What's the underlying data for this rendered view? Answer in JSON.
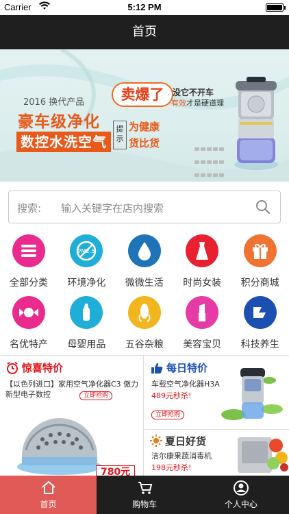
{
  "status_bar": {
    "carrier": "Carrier",
    "time": "5:12 PM"
  },
  "nav": {
    "title": "首页"
  },
  "banner": {
    "subline": "2016 换代产品",
    "headline": "豪车级净化",
    "headline2": "数控水洗空气",
    "hot": "卖爆了",
    "hot_note1": "没它不开车",
    "hot_note2_em": "有效",
    "hot_note2_rest": "才是硬道理",
    "tip": "提示",
    "claim1": "为健康",
    "claim2": "货比货",
    "page_count": 2,
    "active_page": 1
  },
  "search": {
    "label": "搜索:",
    "placeholder": "输入关键字在店内搜索"
  },
  "categories": [
    {
      "label": "全部分类",
      "icon": "list-icon",
      "color": "#ea2a8d"
    },
    {
      "label": "环境净化",
      "icon": "pm25-icon",
      "color": "#1eaed8"
    },
    {
      "label": "微微生活",
      "icon": "water-drop-icon",
      "color": "#1f74b8"
    },
    {
      "label": "时尚女装",
      "icon": "dress-icon",
      "color": "#e8202f"
    },
    {
      "label": "积分商城",
      "icon": "gift-icon",
      "color": "#f07431"
    },
    {
      "label": "名优特产",
      "icon": "candy-icon",
      "color": "#ea2a8d"
    },
    {
      "label": "母婴用品",
      "icon": "baby-bottle-icon",
      "color": "#1eaed8"
    },
    {
      "label": "五谷杂粮",
      "icon": "corn-icon",
      "color": "#f3b51d"
    },
    {
      "label": "美容宝贝",
      "icon": "lipstick-icon",
      "color": "#e63aa4"
    },
    {
      "label": "科技养生",
      "icon": "tech-logo-icon",
      "color": "#1c50b0"
    }
  ],
  "promos": {
    "left": {
      "title": "惊喜特价",
      "desc": "【以色列进口】家用空气净化器C3 傲力新型电子数控",
      "button": "立即抢购",
      "price_tag": "780元"
    },
    "right_top": {
      "title": "每日特价",
      "desc": "车载空气净化器H3A",
      "price": "489元秒杀!",
      "button": "立即抢购"
    },
    "right_bottom": {
      "title": "夏日好货",
      "desc": "洁尔康果蔬消毒机",
      "price": "198元秒杀!"
    }
  },
  "tabs": [
    {
      "label": "首页",
      "icon": "home-icon",
      "active": true
    },
    {
      "label": "购物车",
      "icon": "cart-icon",
      "active": false
    },
    {
      "label": "个人中心",
      "icon": "user-icon",
      "active": false
    }
  ],
  "colors": {
    "nav_bg": "#1f1f1f",
    "accent": "#e05a57",
    "banner_orange": "#e8591a",
    "price_red": "#e3141b"
  }
}
